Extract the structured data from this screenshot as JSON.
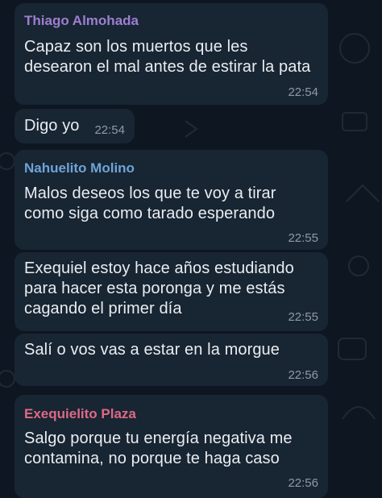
{
  "messages": [
    {
      "sender": "Thiago Almohada",
      "sender_color": "#9d7fd0",
      "lines": [
        "Capaz son los muertos que les",
        "desearon el mal antes de estirar la pata"
      ],
      "time": "22:54"
    },
    {
      "lines": [
        "Digo yo"
      ],
      "time": "22:54"
    },
    {
      "sender": "Nahuelito Molino",
      "sender_color": "#6ea4d8",
      "lines": [
        "Malos deseos los que te voy a tirar",
        "como siga como tarado esperando"
      ],
      "time": "22:55"
    },
    {
      "lines": [
        "Exequiel estoy hace años estudiando",
        "para hacer esta poronga y me estás",
        "cagando el primer día"
      ],
      "time": "22:55"
    },
    {
      "lines": [
        "Salí o vos vas a estar en la morgue"
      ],
      "time": "22:56"
    },
    {
      "sender": "Exequielito Plaza",
      "sender_color": "#e06885",
      "lines": [
        "Salgo porque tu energía negativa me",
        "contamina, no porque te haga caso"
      ],
      "time": "22:56"
    }
  ],
  "colors": {
    "background": "#0e1621",
    "bubble": "#182533",
    "text": "#e9edf1",
    "timestamp": "#8e9aa6"
  }
}
